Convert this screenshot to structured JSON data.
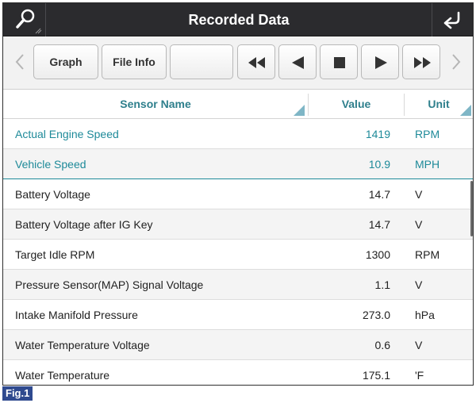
{
  "header": {
    "title": "Recorded Data",
    "search_icon": "search-magnifier-icon",
    "back_icon": "return-arrow-icon"
  },
  "toolbar": {
    "prev_icon": "chevron-left-icon",
    "graph_label": "Graph",
    "file_info_label": "File Info",
    "blank_label": "",
    "rewind_icon": "fast-rewind-icon",
    "step_back_icon": "play-reverse-icon",
    "stop_icon": "stop-icon",
    "play_icon": "play-icon",
    "fast_forward_icon": "fast-forward-icon",
    "next_icon": "chevron-right-icon"
  },
  "table": {
    "columns": {
      "name": "Sensor Name",
      "value": "Value",
      "unit": "Unit"
    },
    "rows": [
      {
        "name": "Actual Engine Speed",
        "value": "1419",
        "unit": "RPM",
        "selected": true
      },
      {
        "name": "Vehicle Speed",
        "value": "10.9",
        "unit": "MPH",
        "selected": true
      },
      {
        "name": "Battery Voltage",
        "value": "14.7",
        "unit": "V",
        "selected": false
      },
      {
        "name": "Battery Voltage after IG Key",
        "value": "14.7",
        "unit": "V",
        "selected": false
      },
      {
        "name": "Target Idle RPM",
        "value": "1300",
        "unit": "RPM",
        "selected": false
      },
      {
        "name": "Pressure Sensor(MAP) Signal Voltage",
        "value": "1.1",
        "unit": "V",
        "selected": false
      },
      {
        "name": "Intake Manifold Pressure",
        "value": "273.0",
        "unit": "hPa",
        "selected": false
      },
      {
        "name": "Water Temperature Voltage",
        "value": "0.6",
        "unit": "V",
        "selected": false
      },
      {
        "name": "Water Temperature",
        "value": "175.1",
        "unit": "'F",
        "selected": false
      }
    ]
  },
  "figure_label": "Fig.1",
  "colors": {
    "title_bar": "#2b2b2e",
    "accent_teal": "#1e8a99",
    "figure_label_bg": "#2f4a8f"
  }
}
